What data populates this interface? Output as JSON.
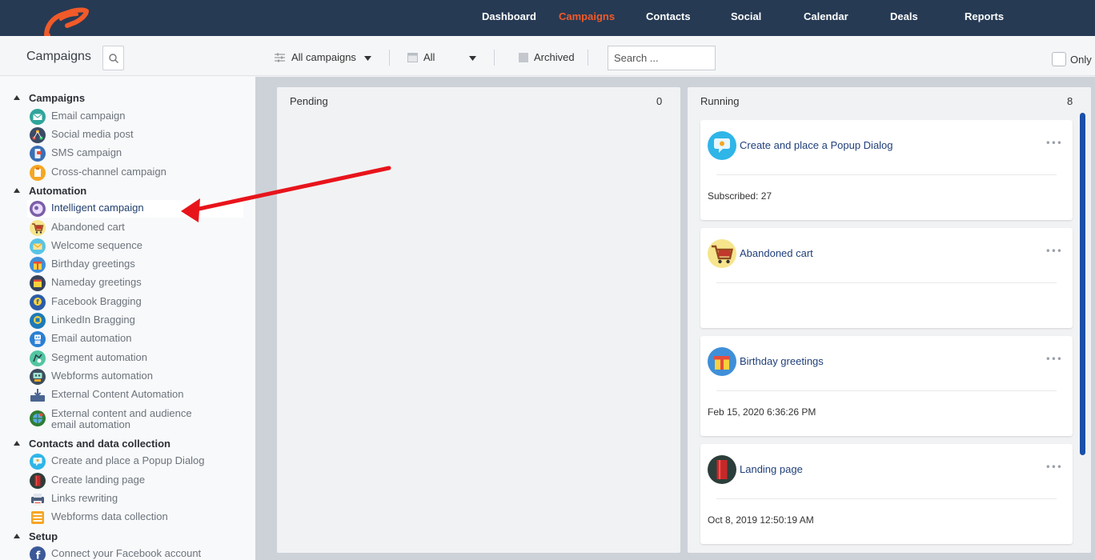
{
  "nav": {
    "items": [
      {
        "label": "Dashboard",
        "active": false
      },
      {
        "label": "Campaigns",
        "active": true
      },
      {
        "label": "Contacts",
        "active": false
      },
      {
        "label": "Social",
        "active": false
      },
      {
        "label": "Calendar",
        "active": false
      },
      {
        "label": "Deals",
        "active": false
      },
      {
        "label": "Reports",
        "active": false
      }
    ],
    "active_color": "#f15a29",
    "bar_color": "#263a54"
  },
  "toolbar": {
    "title": "Campaigns",
    "filter_campaigns": "All campaigns",
    "filter_date": "All",
    "archived_label": "Archived",
    "search_placeholder": "Search ...",
    "only_label": "Only"
  },
  "sidebar": {
    "sections": [
      {
        "label": "Campaigns",
        "items": [
          "Email campaign",
          "Social media post",
          "SMS campaign",
          "Cross-channel campaign"
        ]
      },
      {
        "label": "Automation",
        "items": [
          "Intelligent campaign",
          "Abandoned cart",
          "Welcome sequence",
          "Birthday greetings",
          "Nameday greetings",
          "Facebook Bragging",
          "LinkedIn Bragging",
          "Email automation",
          "Segment automation",
          "Webforms automation",
          "External Content Automation",
          "External content and audience email automation"
        ]
      },
      {
        "label": "Contacts and data collection",
        "items": [
          "Create and place a Popup Dialog",
          "Create landing page",
          "Links rewriting",
          "Webforms data collection"
        ]
      },
      {
        "label": "Setup",
        "items": [
          "Connect your Facebook account"
        ]
      }
    ],
    "selected_item": "Intelligent campaign"
  },
  "board": {
    "pending": {
      "title": "Pending",
      "count": "0"
    },
    "running": {
      "title": "Running",
      "count": "8",
      "cards": [
        {
          "title": "Create and place a Popup Dialog",
          "info": "Subscribed: 27",
          "icon": "popup-dialog-icon"
        },
        {
          "title": "Abandoned cart",
          "info": "",
          "icon": "shopping-cart-icon"
        },
        {
          "title": "Birthday greetings",
          "info": "Feb 15, 2020 6:36:26 PM",
          "icon": "gift-icon"
        },
        {
          "title": "Landing page",
          "info": "Oct 8, 2019 12:50:19 AM",
          "icon": "landing-page-icon"
        }
      ]
    }
  },
  "annotation_color": "#e8141b"
}
